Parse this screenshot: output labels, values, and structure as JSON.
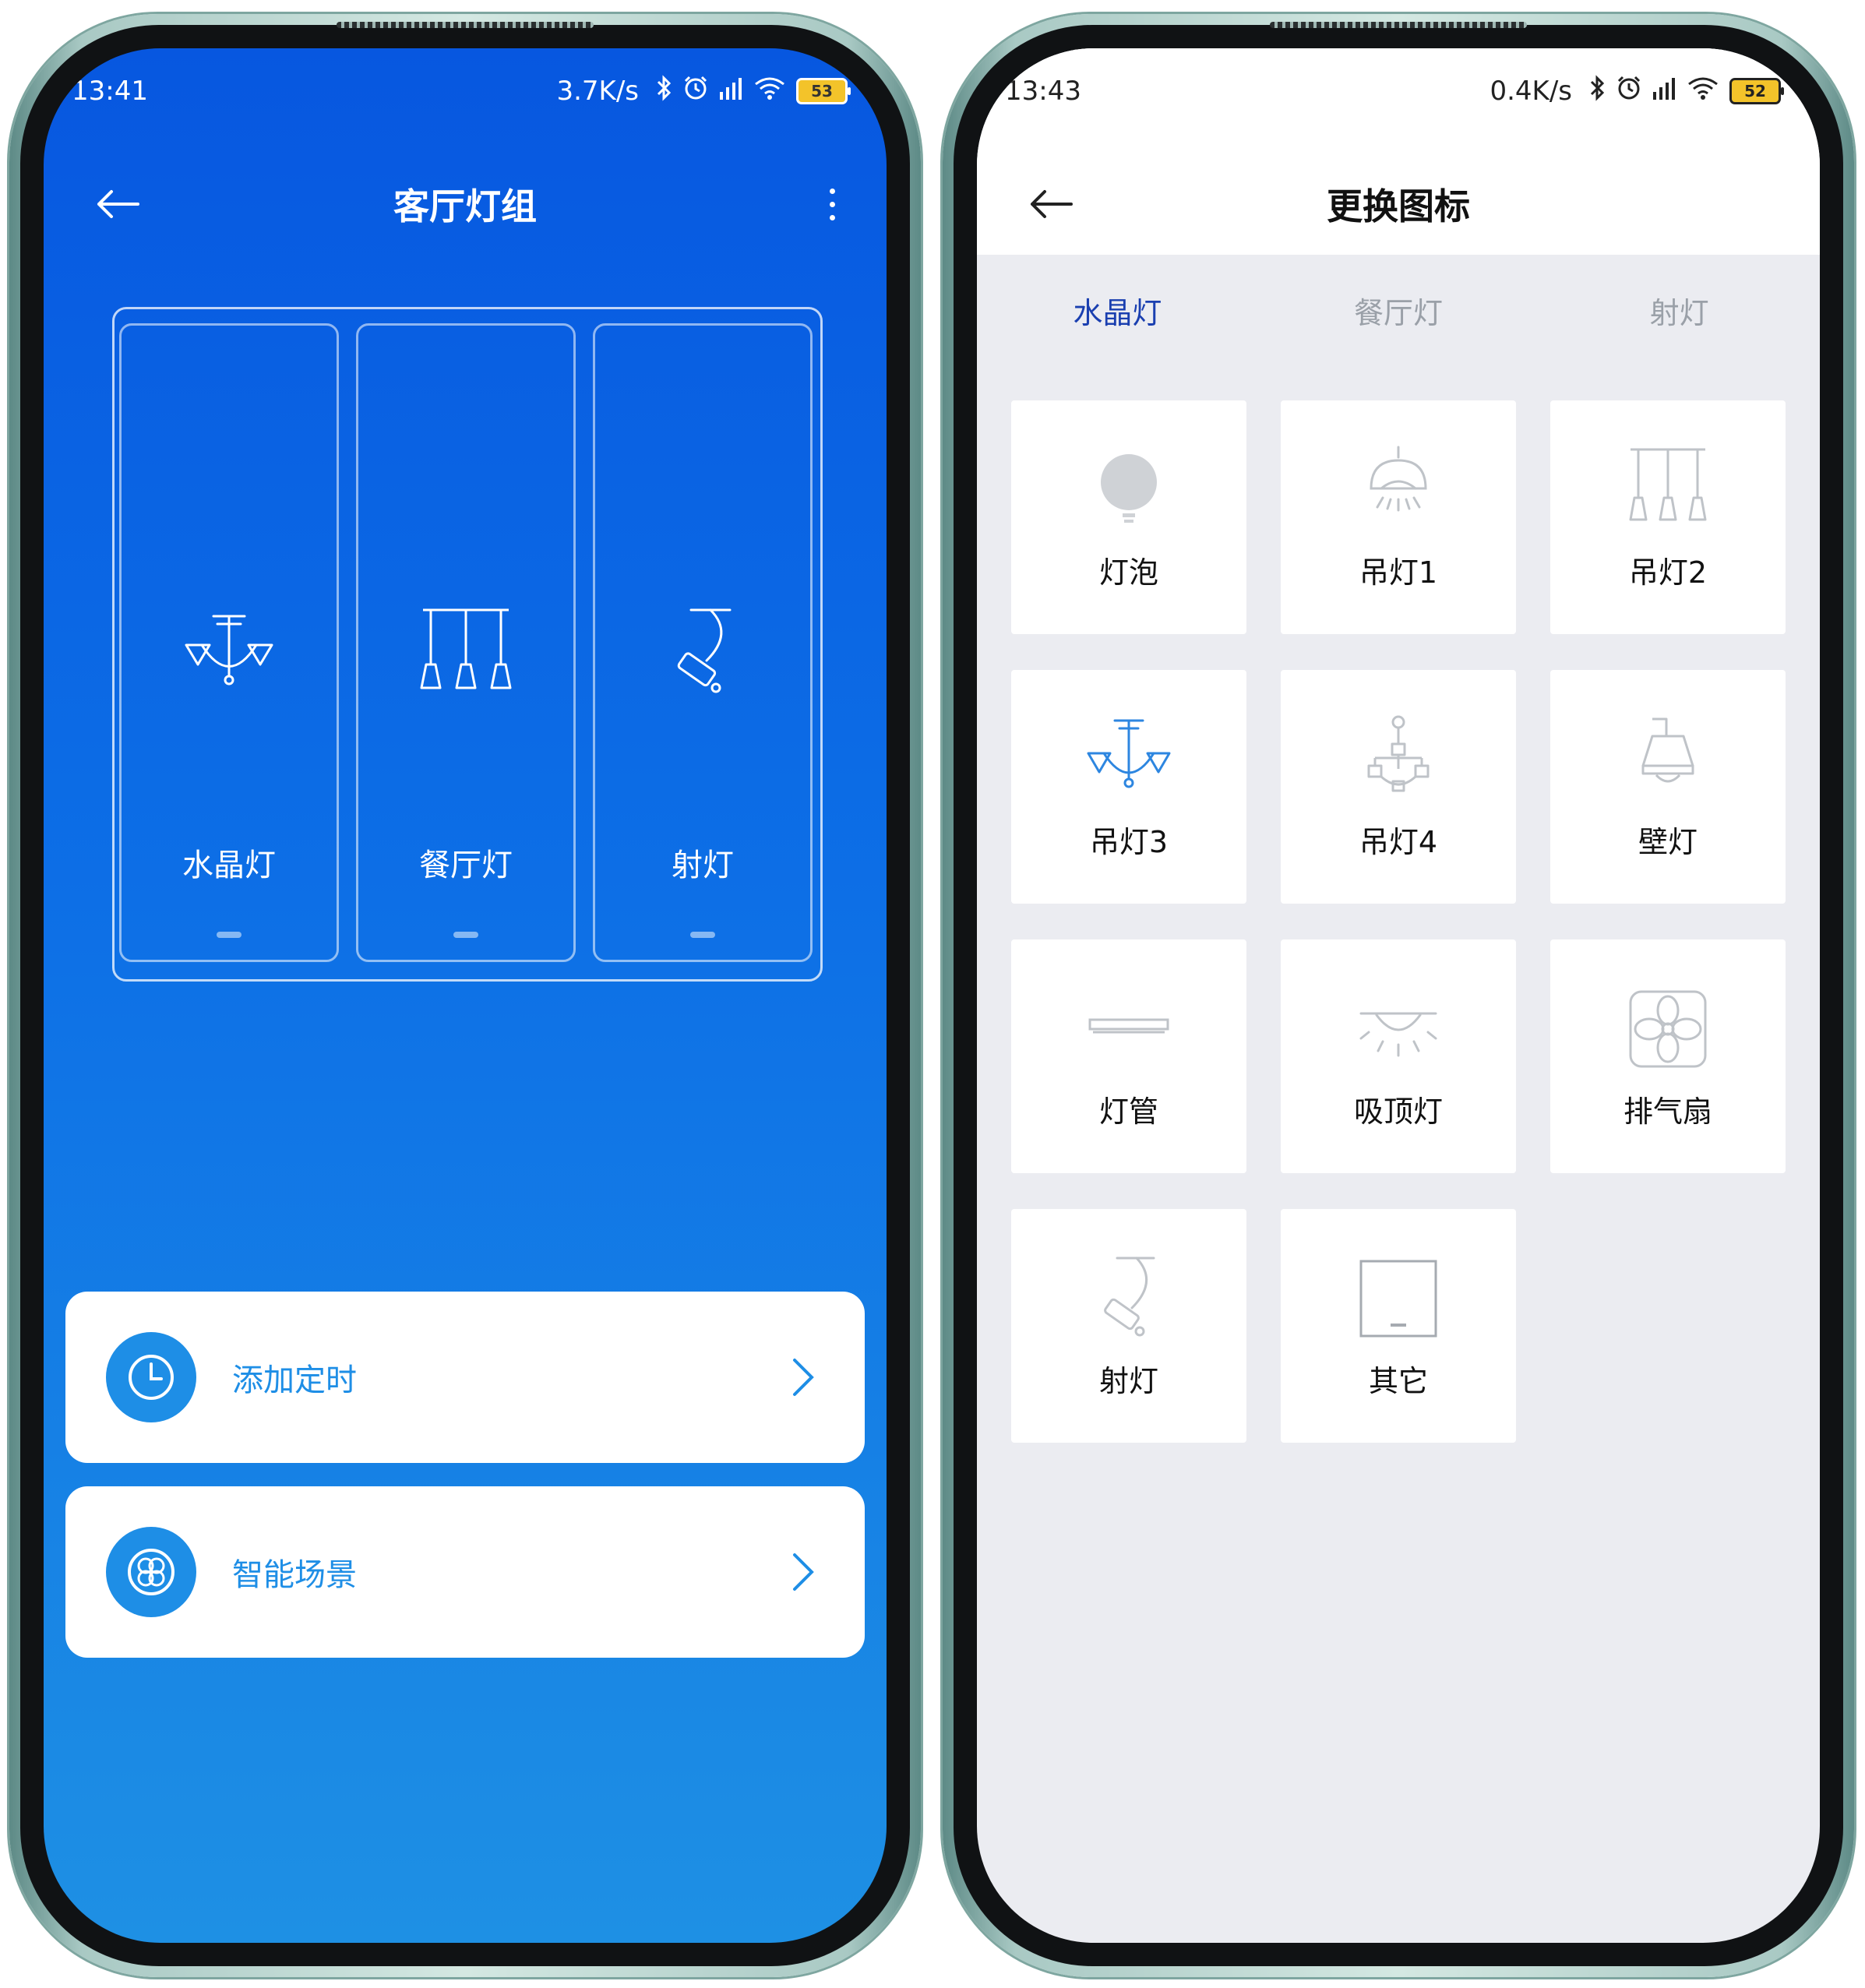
{
  "colors": {
    "accent_blue": "#1e8ee6",
    "tab_active": "#1a3fb0",
    "tab_inactive": "#9aa0a8",
    "icon_gray": "#c3c7cc",
    "icon_blue": "#2d86e0",
    "battery_yellow": "#f3c32a"
  },
  "left": {
    "status": {
      "time": "13:41",
      "speed": "3.7K/s",
      "battery": "53"
    },
    "title": "客厅灯组",
    "switches": [
      {
        "label": "水晶灯",
        "icon": "crystal-chandelier-icon"
      },
      {
        "label": "餐厅灯",
        "icon": "pendant-lights-icon"
      },
      {
        "label": "射灯",
        "icon": "spotlight-icon"
      }
    ],
    "actions": [
      {
        "label": "添加定时",
        "icon": "clock-icon"
      },
      {
        "label": "智能场景",
        "icon": "scene-icon"
      }
    ]
  },
  "right": {
    "status": {
      "time": "13:43",
      "speed": "0.4K/s",
      "battery": "52"
    },
    "title": "更换图标",
    "tabs": [
      {
        "label": "水晶灯",
        "active": true
      },
      {
        "label": "餐厅灯",
        "active": false
      },
      {
        "label": "射灯",
        "active": false
      }
    ],
    "icons": [
      {
        "label": "灯泡",
        "icon": "bulb-icon",
        "selected": false
      },
      {
        "label": "吊灯1",
        "icon": "pendant-lamp-1-icon",
        "selected": false
      },
      {
        "label": "吊灯2",
        "icon": "pendant-lamp-2-icon",
        "selected": false
      },
      {
        "label": "吊灯3",
        "icon": "pendant-lamp-3-icon",
        "selected": true
      },
      {
        "label": "吊灯4",
        "icon": "pendant-lamp-4-icon",
        "selected": false
      },
      {
        "label": "壁灯",
        "icon": "wall-lamp-icon",
        "selected": false
      },
      {
        "label": "灯管",
        "icon": "tube-light-icon",
        "selected": false
      },
      {
        "label": "吸顶灯",
        "icon": "ceiling-light-icon",
        "selected": false
      },
      {
        "label": "排气扇",
        "icon": "exhaust-fan-icon",
        "selected": false
      },
      {
        "label": "射灯",
        "icon": "spotlight-icon",
        "selected": false
      },
      {
        "label": "其它",
        "icon": "other-switch-icon",
        "selected": false
      }
    ]
  }
}
